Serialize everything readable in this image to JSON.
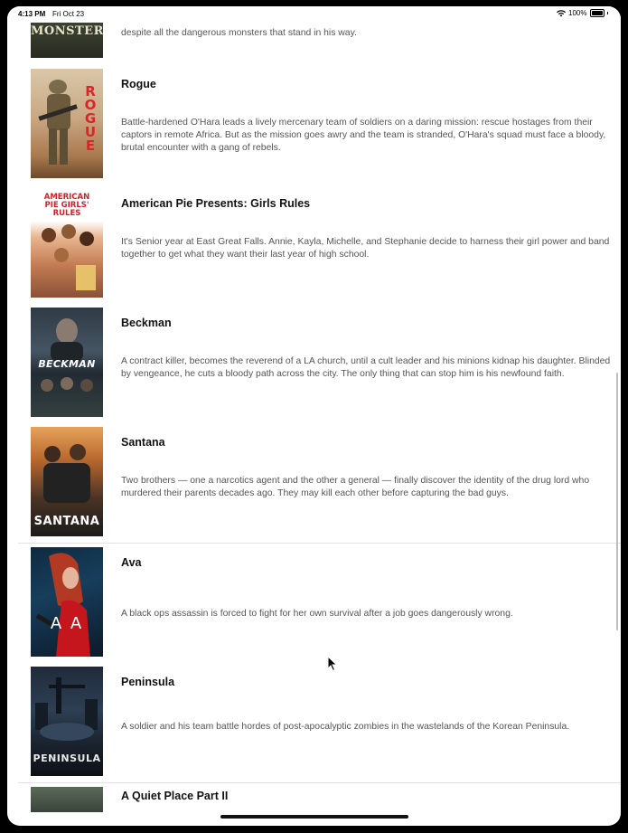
{
  "status_bar": {
    "time": "4:13 PM",
    "date": "Fri Oct 23",
    "battery": "100%",
    "wifi_icon": "wifi-icon",
    "battery_icon": "battery-icon"
  },
  "movies": [
    {
      "title": "",
      "poster_text": "MONSTERS",
      "description": "despite all the dangerous monsters that stand in his way."
    },
    {
      "title": "Rogue",
      "poster_text": "ROGUE",
      "description": "Battle-hardened O'Hara leads a lively mercenary team of soldiers on a daring mission: rescue hostages from their captors in remote Africa. But as the mission goes awry and the team is stranded, O'Hara's squad must face a bloody, brutal encounter with a gang of rebels."
    },
    {
      "title": "American Pie Presents: Girls Rules",
      "poster_text": "AMERICAN PIE GIRLS' RULES",
      "description": "It's Senior year at East Great Falls. Annie, Kayla, Michelle, and Stephanie decide to harness their girl power and band together to get what they want their last year of high school."
    },
    {
      "title": "Beckman",
      "poster_text": "BECKMAN",
      "description": "A contract killer, becomes the reverend of a LA church, until a cult leader and his minions kidnap his daughter. Blinded by vengeance, he cuts a bloody path across the city. The only thing that can stop him is his newfound faith."
    },
    {
      "title": "Santana",
      "poster_text": "SANTANA",
      "description": "Two brothers — one a narcotics agent and the other a general — finally discover the identity of the drug lord who murdered their parents decades ago. They may kill each other before capturing the bad guys."
    },
    {
      "title": "Ava",
      "poster_text": "A  A",
      "description": "A black ops assassin is forced to fight for her own survival after a job goes dangerously wrong."
    },
    {
      "title": "Peninsula",
      "poster_text": "PENINSULA",
      "description": "A soldier and his team battle hordes of post-apocalyptic zombies in the wastelands of the Korean Peninsula."
    },
    {
      "title": "A Quiet Place Part II",
      "poster_text": "",
      "description": ""
    }
  ],
  "colors": {
    "background": "#ffffff",
    "title": "#111111",
    "description": "#555555",
    "rogue_red": "#d8262a"
  }
}
